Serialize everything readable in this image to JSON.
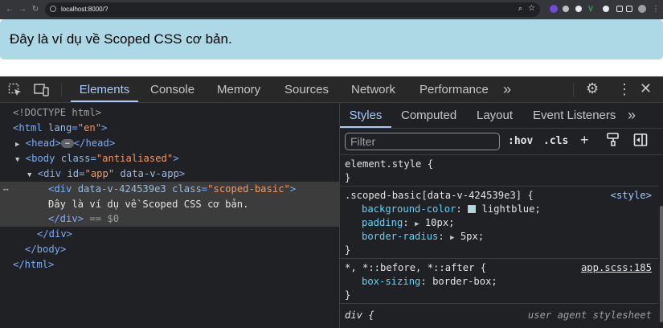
{
  "browser": {
    "url": "localhost:8000/?"
  },
  "page": {
    "content_text": "Đây là ví dụ về Scoped CSS cơ bản."
  },
  "devtools": {
    "tabs": [
      "Elements",
      "Console",
      "Memory",
      "Sources",
      "Network",
      "Performance"
    ],
    "more_tabs": "»",
    "elements_tree": {
      "doctype": "<!DOCTYPE html>",
      "html_open": "<html",
      "html_lang_attr": "lang",
      "html_lang_val": "\"en\"",
      "head_open": "<head>",
      "head_ellipsis": "…",
      "head_close": "</head>",
      "body_open": "<body",
      "body_class_attr": "class",
      "body_class_val": "\"antialiased\"",
      "div_app_open": "<div",
      "div_app_id_attr": "id",
      "div_app_id_val": "\"app\"",
      "div_app_data_attr": "data-v-app",
      "div_scoped_open": "<div",
      "div_scoped_data_attr": "data-v-424539e3",
      "div_scoped_class_attr": "class",
      "div_scoped_class_val": "\"scoped-basic\"",
      "div_scoped_text": "Đây là ví dụ về Scoped CSS cơ bản.",
      "div_close_selected": "</div>",
      "selected_marker": "== $0",
      "div_close": "</div>",
      "body_close": "</body>",
      "html_close": "</html>"
    },
    "styles_tabs": [
      "Styles",
      "Computed",
      "Layout",
      "Event Listeners"
    ],
    "filter_placeholder": "Filter",
    "hov_label": ":hov",
    "cls_label": ".cls",
    "rules": {
      "element_style_selector": "element.style {",
      "close_brace": "}",
      "scoped_selector": ".scoped-basic[data-v-424539e3] {",
      "scoped_source": "<style>",
      "bg_prop": "background-color",
      "bg_val": "lightblue;",
      "padding_prop": "padding",
      "padding_val": "10px;",
      "radius_prop": "border-radius",
      "radius_val": "5px;",
      "universal_selector": "*, *::before, *::after {",
      "universal_source": "app.scss:185",
      "box_sizing_prop": "box-sizing",
      "box_sizing_val": "border-box;",
      "div_selector": "div {",
      "div_source": "user agent stylesheet"
    },
    "colors": {
      "swatch": "#add8e6",
      "accent": "#a8c7fa"
    }
  }
}
